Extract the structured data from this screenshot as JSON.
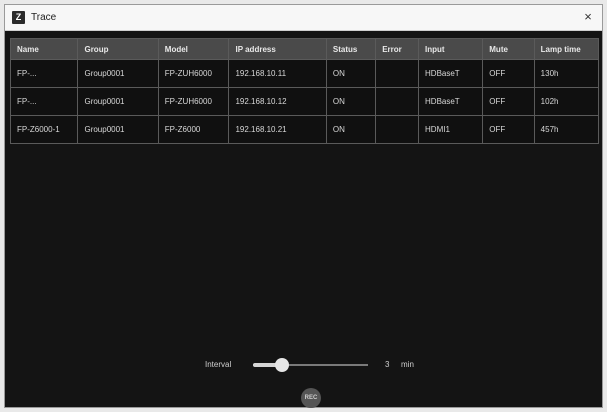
{
  "window": {
    "title": "Trace",
    "app_icon": "trace-app-icon",
    "close_glyph": "×"
  },
  "table": {
    "headers": [
      "Name",
      "Group",
      "Model",
      "IP address",
      "Status",
      "Error",
      "Input",
      "Mute",
      "Lamp time"
    ],
    "rows": [
      [
        "FP-...",
        "Group0001",
        "FP-ZUH6000",
        "192.168.10.11",
        "ON",
        "",
        "HDBaseT",
        "OFF",
        "130h"
      ],
      [
        "FP-...",
        "Group0001",
        "FP-ZUH6000",
        "192.168.10.12",
        "ON",
        "",
        "HDBaseT",
        "OFF",
        "102h"
      ],
      [
        "FP-Z6000-1",
        "Group0001",
        "FP-Z6000",
        "192.168.10.21",
        "ON",
        "",
        "HDMI1",
        "OFF",
        "457h"
      ]
    ]
  },
  "interval": {
    "label": "Interval",
    "value": "3",
    "unit": "min",
    "slider_fraction": 0.25
  },
  "rec_button": {
    "label": "REC"
  },
  "colors": {
    "background": "#141414",
    "header_bg": "#4a4a4a",
    "grid": "#5a5a5a",
    "text": "#d8d8d8"
  }
}
